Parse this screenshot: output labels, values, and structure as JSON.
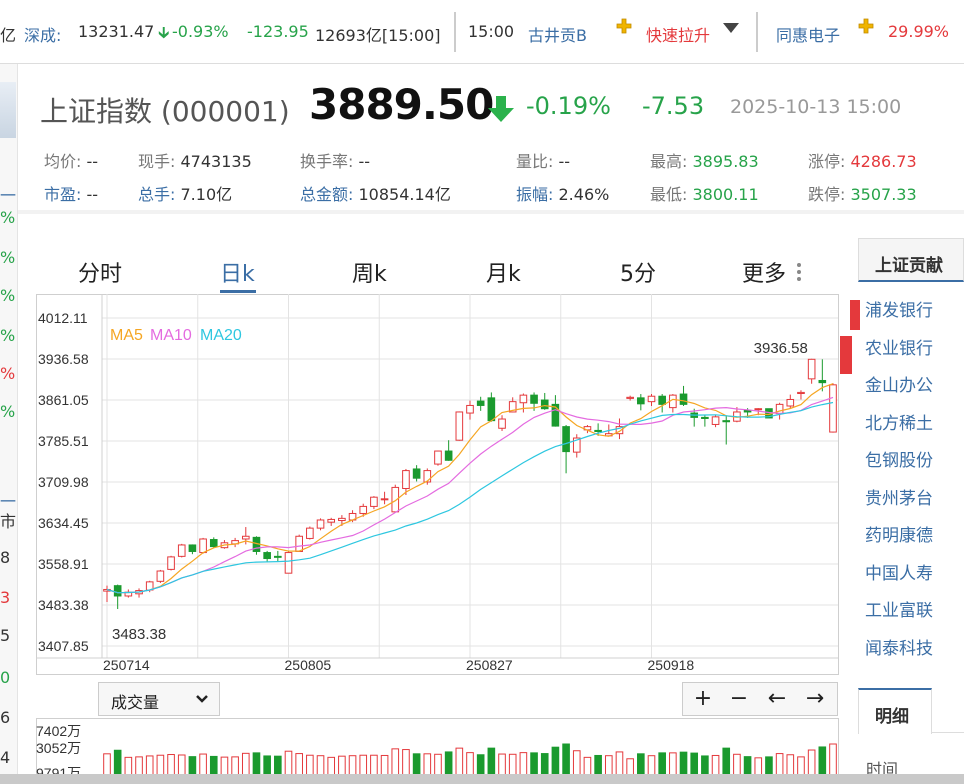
{
  "ticker": {
    "lead": "亿",
    "sz_label": "深成:",
    "sz_value": "13231.47",
    "sz_pct": "-0.93%",
    "sz_chg": "-123.95",
    "sz_amount": "12693亿[15:00]",
    "time": "15:00",
    "stock1": "古井贡B",
    "event1": "快速拉升",
    "stock2": "同惠电子",
    "stock2_pct": "29.99%"
  },
  "left_strip": [
    "一",
    "%",
    "%",
    "%",
    "%",
    "%",
    "%",
    "一",
    "市",
    "8",
    "3",
    "5",
    "0",
    "6",
    "4"
  ],
  "quote": {
    "title": "上证指数 (000001)",
    "price": "3889.50",
    "pct": "-0.19%",
    "chg": "-7.53",
    "time": "2025-10-13 15:00",
    "stats": {
      "avg_label": "均价:",
      "avg": "--",
      "cur_label": "现手:",
      "cur": "4743135",
      "turnover_label": "换手率:",
      "turnover": "--",
      "vr_label": "量比:",
      "vr": "--",
      "high_label": "最高:",
      "high": "3895.83",
      "limitup_label": "涨停:",
      "limitup": "4286.73",
      "pe_label": "市盈:",
      "pe": "--",
      "vol_label": "总手:",
      "vol": "7.10亿",
      "amount_label": "总金额:",
      "amount": "10854.14亿",
      "amp_label": "振幅:",
      "amp": "2.46%",
      "low_label": "最低:",
      "low": "3800.11",
      "limitdown_label": "跌停:",
      "limitdown": "3507.33"
    }
  },
  "tabs": [
    "分时",
    "日k",
    "周k",
    "月k",
    "5分",
    "更多"
  ],
  "active_tab": "日k",
  "chart_data": {
    "type": "candlestick",
    "y_ticks": [
      "4012.11",
      "3936.58",
      "3861.05",
      "3785.51",
      "3709.98",
      "3634.45",
      "3558.91",
      "3483.38",
      "3407.85"
    ],
    "ylim": [
      3407.85,
      4012.11
    ],
    "x_ticks": [
      {
        "label": "250714",
        "index": 0
      },
      {
        "label": "250805",
        "index": 17
      },
      {
        "label": "250827",
        "index": 34
      },
      {
        "label": "250918",
        "index": 51
      }
    ],
    "legend": [
      "MA5",
      "MA10",
      "MA20"
    ],
    "ma_colors": {
      "MA5": "#f5a623",
      "MA10": "#e46be0",
      "MA20": "#2ec7e0"
    },
    "up_color": "#e4393c",
    "down_color": "#1a9a2e",
    "max_label": "3936.58",
    "min_label": "3483.38",
    "candles": [
      [
        3509,
        3519,
        3489,
        3512
      ],
      [
        3519,
        3521,
        3476,
        3500
      ],
      [
        3500,
        3512,
        3497,
        3507
      ],
      [
        3504,
        3514,
        3497,
        3510
      ],
      [
        3511,
        3528,
        3507,
        3526
      ],
      [
        3527,
        3548,
        3524,
        3546
      ],
      [
        3549,
        3574,
        3547,
        3572
      ],
      [
        3573,
        3596,
        3571,
        3594
      ],
      [
        3594,
        3595,
        3577,
        3582
      ],
      [
        3580,
        3607,
        3578,
        3605
      ],
      [
        3604,
        3608,
        3589,
        3591
      ],
      [
        3589,
        3603,
        3587,
        3598
      ],
      [
        3596,
        3607,
        3590,
        3602
      ],
      [
        3605,
        3627,
        3595,
        3610
      ],
      [
        3608,
        3610,
        3576,
        3582
      ],
      [
        3580,
        3583,
        3562,
        3569
      ],
      [
        3573,
        3583,
        3563,
        3572
      ],
      [
        3542,
        3583,
        3542,
        3580
      ],
      [
        3582,
        3613,
        3582,
        3610
      ],
      [
        3606,
        3628,
        3604,
        3625
      ],
      [
        3625,
        3643,
        3621,
        3640
      ],
      [
        3636,
        3644,
        3629,
        3641
      ],
      [
        3639,
        3649,
        3629,
        3643
      ],
      [
        3640,
        3658,
        3636,
        3652
      ],
      [
        3652,
        3670,
        3646,
        3665
      ],
      [
        3665,
        3684,
        3660,
        3682
      ],
      [
        3679,
        3692,
        3669,
        3679
      ],
      [
        3655,
        3705,
        3654,
        3700
      ],
      [
        3698,
        3734,
        3686,
        3731
      ],
      [
        3734,
        3741,
        3711,
        3717
      ],
      [
        3710,
        3735,
        3705,
        3731
      ],
      [
        3743,
        3768,
        3740,
        3767
      ],
      [
        3767,
        3787,
        3749,
        3750
      ],
      [
        3787,
        3840,
        3786,
        3839
      ],
      [
        3837,
        3860,
        3825,
        3851
      ],
      [
        3859,
        3867,
        3841,
        3851
      ],
      [
        3865,
        3875,
        3821,
        3823
      ],
      [
        3809,
        3833,
        3804,
        3826
      ],
      [
        3839,
        3866,
        3838,
        3858
      ],
      [
        3856,
        3873,
        3838,
        3870
      ],
      [
        3870,
        3875,
        3841,
        3855
      ],
      [
        3861,
        3874,
        3843,
        3845
      ],
      [
        3853,
        3870,
        3812,
        3813
      ],
      [
        3812,
        3815,
        3726,
        3766
      ],
      [
        3765,
        3798,
        3755,
        3791
      ],
      [
        3806,
        3815,
        3800,
        3812
      ],
      [
        3805,
        3818,
        3795,
        3803
      ],
      [
        3795,
        3816,
        3794,
        3799
      ],
      [
        3799,
        3827,
        3789,
        3812
      ],
      [
        3864,
        3869,
        3860,
        3866
      ],
      [
        3865,
        3872,
        3842,
        3854
      ],
      [
        3858,
        3872,
        3850,
        3868
      ],
      [
        3868,
        3872,
        3838,
        3853
      ],
      [
        3847,
        3872,
        3838,
        3870
      ],
      [
        3872,
        3887,
        3850,
        3853
      ],
      [
        3837,
        3845,
        3812,
        3829
      ],
      [
        3829,
        3833,
        3812,
        3827
      ],
      [
        3816,
        3834,
        3811,
        3830
      ],
      [
        3823,
        3833,
        3779,
        3821
      ],
      [
        3822,
        3848,
        3820,
        3839
      ],
      [
        3842,
        3846,
        3828,
        3839
      ],
      [
        3844,
        3846,
        3833,
        3845
      ],
      [
        3845,
        3845,
        3828,
        3828
      ],
      [
        3836,
        3856,
        3825,
        3853
      ],
      [
        3850,
        3871,
        3845,
        3862
      ],
      [
        3873,
        3879,
        3862,
        3875
      ],
      [
        3900,
        3937,
        3891,
        3936
      ],
      [
        3897,
        3936,
        3877,
        3893
      ],
      [
        3802,
        3892,
        3801,
        3889
      ]
    ],
    "volume_labels": [
      "7402万",
      "3052万",
      "9791万"
    ],
    "volume_select": "成交量"
  },
  "zoom_buttons": [
    "+",
    "−",
    "←",
    "→"
  ],
  "right_panel": {
    "title": "上证贡献",
    "items": [
      "浦发银行",
      "农业银行",
      "金山办公",
      "北方稀土",
      "包钢股份",
      "贵州茅台",
      "药明康德",
      "中国人寿",
      "工业富联",
      "闻泰科技"
    ],
    "tab": "明细",
    "time_label": "时间"
  }
}
